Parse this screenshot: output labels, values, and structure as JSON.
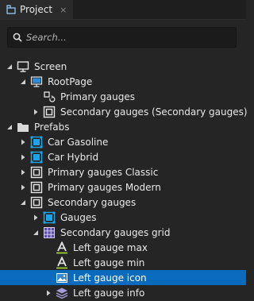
{
  "panel": {
    "title": "Project",
    "close_glyph": "×",
    "icon": "project-icon"
  },
  "search": {
    "placeholder": "Search..."
  },
  "tree": [
    {
      "label": "Screen",
      "icon": "screen-icon",
      "expander": "expanded"
    },
    {
      "label": "RootPage",
      "icon": "page-icon",
      "expander": "expanded"
    },
    {
      "label": "Primary gauges",
      "icon": "state-machine-icon",
      "expander": "none"
    },
    {
      "label": "Secondary gauges (Secondary gauges)",
      "icon": "node-icon",
      "expander": "collapsed"
    },
    {
      "label": "Prefabs",
      "icon": "folder-icon",
      "expander": "expanded"
    },
    {
      "label": "Car Gasoline",
      "icon": "blue-node-icon",
      "expander": "collapsed"
    },
    {
      "label": "Car Hybrid",
      "icon": "blue-node-icon",
      "expander": "collapsed"
    },
    {
      "label": "Primary gauges Classic",
      "icon": "node-icon",
      "expander": "collapsed"
    },
    {
      "label": "Primary gauges Modern",
      "icon": "node-icon",
      "expander": "collapsed"
    },
    {
      "label": "Secondary gauges",
      "icon": "node-icon",
      "expander": "expanded"
    },
    {
      "label": "Gauges",
      "icon": "blue-node-icon",
      "expander": "collapsed"
    },
    {
      "label": "Secondary gauges grid",
      "icon": "grid-icon",
      "expander": "expanded"
    },
    {
      "label": "Left gauge max",
      "icon": "text-block-icon",
      "expander": "none"
    },
    {
      "label": "Left gauge min",
      "icon": "text-block-icon",
      "expander": "none"
    },
    {
      "label": "Left gauge icon",
      "icon": "image-icon",
      "expander": "none",
      "selected": true
    },
    {
      "label": "Left gauge info",
      "icon": "layers-icon",
      "expander": "collapsed"
    }
  ],
  "colors": {
    "background": "#252526",
    "selection": "#0a6bbd",
    "accent": "#1fa3e8",
    "text": "#e8e8e8"
  }
}
